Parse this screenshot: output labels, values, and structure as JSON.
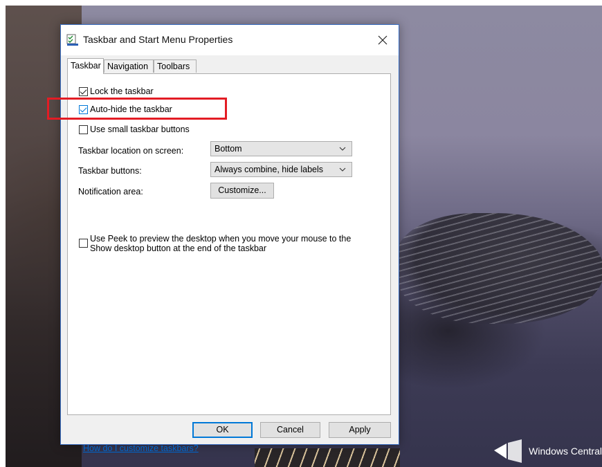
{
  "window": {
    "title": "Taskbar and Start Menu Properties",
    "close_label": "×"
  },
  "tabs": [
    {
      "label": "Taskbar",
      "active": true
    },
    {
      "label": "Navigation",
      "active": false
    },
    {
      "label": "Toolbars",
      "active": false
    }
  ],
  "options": {
    "lock": {
      "label": "Lock the taskbar",
      "checked": true
    },
    "autohide": {
      "label": "Auto-hide the taskbar",
      "checked": true
    },
    "small_buttons": {
      "label": "Use small taskbar buttons",
      "checked": false
    }
  },
  "settings": {
    "location": {
      "label": "Taskbar location on screen:",
      "value": "Bottom"
    },
    "buttons": {
      "label": "Taskbar buttons:",
      "value": "Always combine, hide labels"
    },
    "notification": {
      "label": "Notification area:",
      "button": "Customize..."
    }
  },
  "peek": {
    "line1": "Use Peek to preview the desktop when you move your mouse to the",
    "line2": "Show desktop button at the end of the taskbar",
    "checked": false
  },
  "help_link": "How do I customize taskbars?",
  "footer": {
    "ok": "OK",
    "cancel": "Cancel",
    "apply": "Apply"
  },
  "watermark": "Windows Central",
  "colors": {
    "accent": "#0078d7",
    "highlight": "#e31c24",
    "link": "#0066cc"
  }
}
